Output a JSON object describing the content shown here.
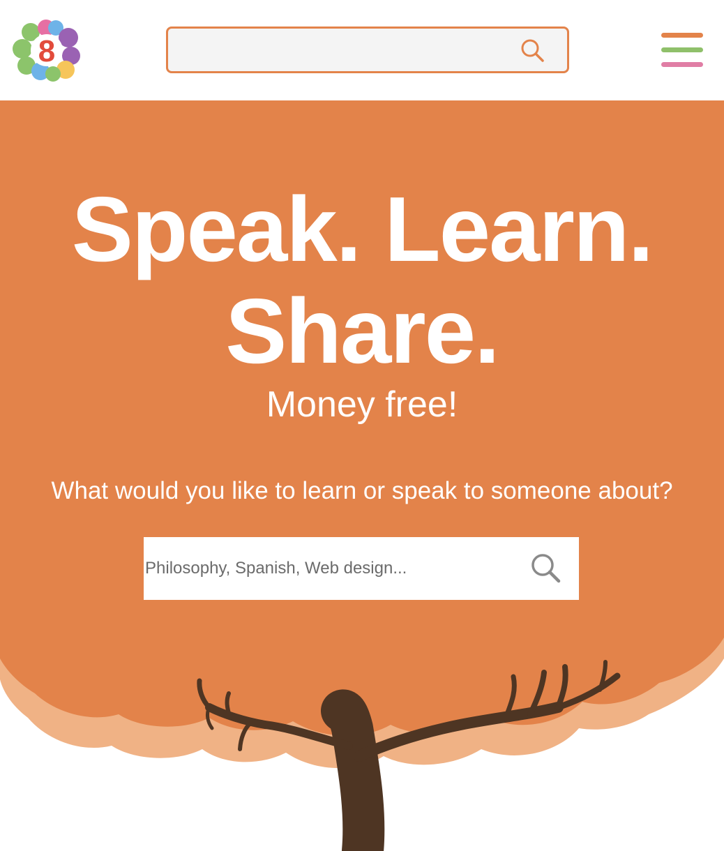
{
  "header": {
    "logo": {
      "icon": "brain-logo-icon",
      "text": "8"
    },
    "search": {
      "value": "",
      "placeholder": "",
      "icon": "search-icon"
    },
    "menu": {
      "icon": "hamburger-menu-icon"
    }
  },
  "hero": {
    "headline_line1": "Speak. Learn.",
    "headline_line2": "Share.",
    "subheadline": "Money free!",
    "prompt": "What would you like to learn or speak to someone about?",
    "search": {
      "value": "",
      "placeholder": "Philosophy, Spanish, Web design...",
      "icon": "search-icon"
    },
    "illustration": "tree-illustration"
  },
  "colors": {
    "brand_orange": "#e3834a",
    "light_orange": "#f0b285",
    "trunk_brown": "#4e3523",
    "menu_bar_green": "#8fc06a",
    "menu_bar_pink": "#e07ea5",
    "logo_green": "#8cc46b",
    "logo_purple": "#9a62b3",
    "logo_blue": "#6eb3e8",
    "logo_yellow": "#f6c55a",
    "logo_pink": "#e66fa3",
    "logo_red": "#e24b3b"
  }
}
